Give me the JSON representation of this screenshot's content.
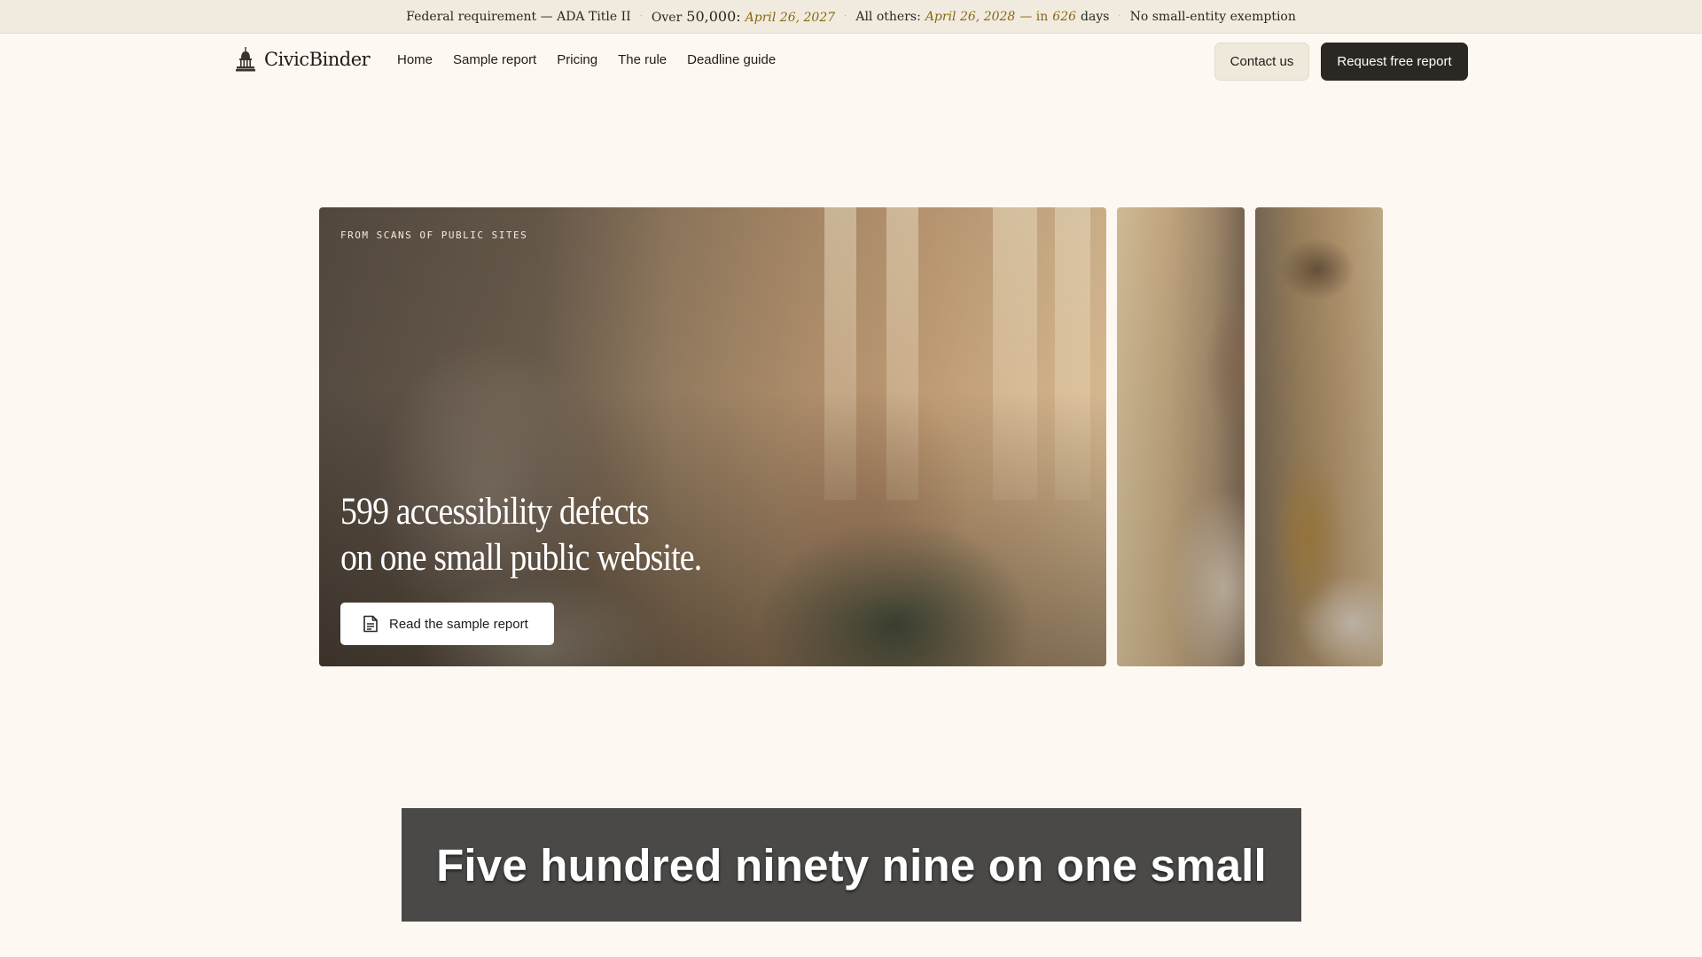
{
  "topbar": {
    "item1": "Federal requirement — ADA Title II",
    "item2_prefix": "Over",
    "item2_number": "50,000:",
    "item2_date": "April 26, 2027",
    "item3_prefix": "All others:",
    "item3_date": "April 26, 2028",
    "item3_mid": "— in",
    "item3_days": "626",
    "item3_suffix": "days",
    "item4": "No small-entity exemption",
    "separator": "·",
    "accent_color": "#8a6512"
  },
  "nav": {
    "brand": "CivicBinder",
    "brand_icon": "capitol-dome-icon",
    "links": [
      "Home",
      "Sample report",
      "Pricing",
      "The rule",
      "Deadline guide"
    ],
    "contact_label": "Contact us",
    "request_label": "Request free report"
  },
  "hero": {
    "eyebrow": "FROM SCANS OF PUBLIC SITES",
    "title_line1": "599 accessibility defects",
    "title_line2": "on one small public website.",
    "button_label": "Read the sample report",
    "button_icon": "document-icon"
  },
  "caption": {
    "text": "Five hundred ninety nine on one small"
  }
}
